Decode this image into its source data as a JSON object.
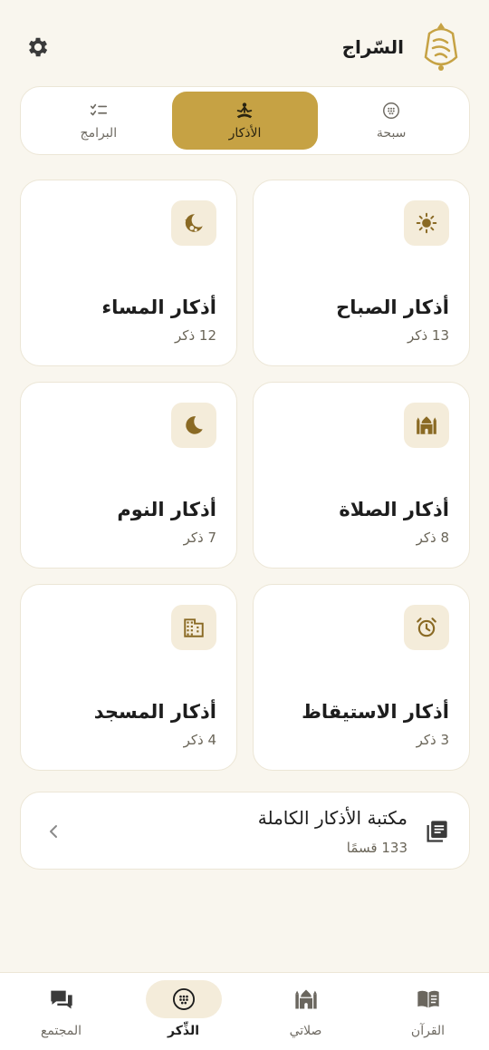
{
  "app": {
    "title": "السّراج"
  },
  "colors": {
    "accent": "#c6a244",
    "icon": "#8a6a24",
    "background": "#f9f6ee",
    "card_icon_bg": "#f4ecda"
  },
  "tabs": [
    {
      "label": "سبحة",
      "icon": "tasbih-icon",
      "active": false
    },
    {
      "label": "الأذكار",
      "icon": "meditation-icon",
      "active": true
    },
    {
      "label": "البرامج",
      "icon": "checklist-icon",
      "active": false
    }
  ],
  "cards": [
    {
      "title": "أذكار الصباح",
      "count": "13 ذكر",
      "icon": "sun-icon"
    },
    {
      "title": "أذكار المساء",
      "count": "12 ذكر",
      "icon": "moon-stars-icon"
    },
    {
      "title": "أذكار الصلاة",
      "count": "8 ذكر",
      "icon": "mosque-icon"
    },
    {
      "title": "أذكار النوم",
      "count": "7 ذكر",
      "icon": "crescent-icon"
    },
    {
      "title": "أذكار الاستيقاظ",
      "count": "3 ذكر",
      "icon": "alarm-icon"
    },
    {
      "title": "أذكار المسجد",
      "count": "4 ذكر",
      "icon": "building-icon"
    }
  ],
  "library": {
    "title": "مكتبة الأذكار الكاملة",
    "count": "133 قسمًا",
    "icon": "library-icon"
  },
  "bottom_nav": [
    {
      "label": "القرآن",
      "icon": "quran-icon",
      "active": false
    },
    {
      "label": "صلاتي",
      "icon": "mosque-icon",
      "active": false
    },
    {
      "label": "الذِّكر",
      "icon": "tasbih-icon",
      "active": true
    },
    {
      "label": "المجتمع",
      "icon": "chat-icon",
      "active": false
    }
  ]
}
